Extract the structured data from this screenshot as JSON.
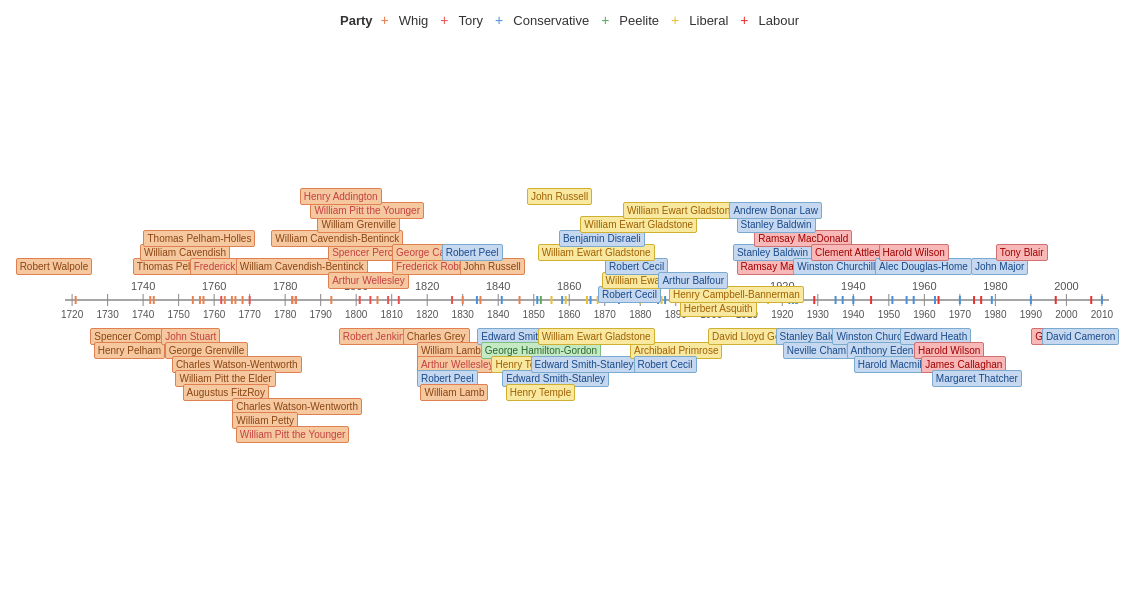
{
  "legend": {
    "party_label": "Party",
    "items": [
      {
        "name": "Whig",
        "color_class": "whig-dot",
        "plus_color": "#e88050"
      },
      {
        "name": "Tory",
        "color_class": "tory-dot",
        "plus_color": "#e85050"
      },
      {
        "name": "Conservative",
        "color_class": "conservative-dot",
        "plus_color": "#4a90d9"
      },
      {
        "name": "Peelite",
        "color_class": "peelite-dot",
        "plus_color": "#5aaa5a"
      },
      {
        "name": "Liberal",
        "color_class": "liberal-dot",
        "plus_color": "#e8c030"
      },
      {
        "name": "Labour",
        "color_class": "labour-dot",
        "plus_color": "#e83030"
      }
    ]
  },
  "axis": {
    "start_year": 1720,
    "end_year": 2010,
    "major_ticks": [
      1720,
      1740,
      1760,
      1780,
      1800,
      1820,
      1840,
      1860,
      1880,
      1900,
      1920,
      1940,
      1960,
      1980,
      2000
    ],
    "top_labels": [
      1740,
      1760,
      1780,
      1800,
      1820,
      1840,
      1860,
      1880,
      1900,
      1920,
      1940,
      1960,
      1980,
      2000
    ],
    "bottom_labels": [
      1720,
      1730,
      1740,
      1750,
      1760,
      1770,
      1780,
      1790,
      1800,
      1810,
      1820,
      1830,
      1840,
      1850,
      1860,
      1870,
      1880,
      1890,
      1900,
      1910,
      1920,
      1930,
      1940,
      1950,
      1960,
      1970,
      1980,
      1990,
      2000,
      2010
    ]
  },
  "prime_ministers": [
    {
      "name": "Robert Walpole",
      "year": 1721,
      "above": true,
      "party": "whig",
      "row": 0
    },
    {
      "name": "Spencer Compton",
      "year": 1742,
      "above": false,
      "party": "whig",
      "row": 0
    },
    {
      "name": "Henry Pelham",
      "year": 1743,
      "above": false,
      "party": "whig",
      "row": 1
    },
    {
      "name": "Thomas Pelham-Holles",
      "year": 1754,
      "above": true,
      "party": "whig",
      "row": 0
    },
    {
      "name": "William Cavendish",
      "year": 1756,
      "above": true,
      "party": "whig",
      "row": 1
    },
    {
      "name": "Thomas Pelham-Holles",
      "year": 1757,
      "above": true,
      "party": "whig",
      "row": 2
    },
    {
      "name": "John Stuart",
      "year": 1762,
      "above": false,
      "party": "tory",
      "row": 0
    },
    {
      "name": "George Grenville",
      "year": 1763,
      "above": false,
      "party": "whig",
      "row": 1
    },
    {
      "name": "Charles Watson-Wentworth",
      "year": 1765,
      "above": false,
      "party": "whig",
      "row": 2
    },
    {
      "name": "William Pitt the Elder",
      "year": 1766,
      "above": false,
      "party": "whig",
      "row": 3
    },
    {
      "name": "Augustus FitzRoy",
      "year": 1768,
      "above": false,
      "party": "whig",
      "row": 4
    },
    {
      "name": "Frederick North",
      "year": 1770,
      "above": true,
      "party": "tory",
      "row": 0
    },
    {
      "name": "Charles Watson-Wentworth",
      "year": 1782,
      "above": false,
      "party": "whig",
      "row": 5
    },
    {
      "name": "William Petty",
      "year": 1782,
      "above": false,
      "party": "whig",
      "row": 6
    },
    {
      "name": "William Cavendish-Bentinck",
      "year": 1783,
      "above": true,
      "party": "whig",
      "row": 0
    },
    {
      "name": "William Pitt the Younger",
      "year": 1783,
      "above": false,
      "party": "tory",
      "row": 7
    },
    {
      "name": "Spencer Perceval",
      "year": 1783,
      "above": true,
      "party": "tory",
      "row": 1
    },
    {
      "name": "William Cavendish-Bentinck",
      "year": 1793,
      "above": true,
      "party": "whig",
      "row": 2
    },
    {
      "name": "William Grenville",
      "year": 1806,
      "above": true,
      "party": "whig",
      "row": 3
    },
    {
      "name": "William Pitt the Younger",
      "year": 1804,
      "above": true,
      "party": "tory",
      "row": 4
    },
    {
      "name": "Henry Addington",
      "year": 1801,
      "above": true,
      "party": "tory",
      "row": 5
    },
    {
      "name": "Arthur Wellesley",
      "year": 1809,
      "above": true,
      "party": "tory",
      "row": -2
    },
    {
      "name": "Frederick Robinson",
      "year": 1827,
      "above": true,
      "party": "tory",
      "row": -1
    },
    {
      "name": "George Canning",
      "year": 1827,
      "above": true,
      "party": "tory",
      "row": 0
    },
    {
      "name": "Robert Jenkinson",
      "year": 1812,
      "above": false,
      "party": "tory",
      "row": 0
    },
    {
      "name": "Charles Grey",
      "year": 1830,
      "above": false,
      "party": "whig",
      "row": 0
    },
    {
      "name": "William Lamb",
      "year": 1834,
      "above": false,
      "party": "whig",
      "row": 1
    },
    {
      "name": "Arthur Wellesley",
      "year": 1834,
      "above": false,
      "party": "tory",
      "row": 2
    },
    {
      "name": "Robert Peel",
      "year": 1834,
      "above": false,
      "party": "conservative",
      "row": 3
    },
    {
      "name": "William Lamb",
      "year": 1835,
      "above": false,
      "party": "whig",
      "row": 4
    },
    {
      "name": "John Russell",
      "year": 1846,
      "above": true,
      "party": "whig",
      "row": 0
    },
    {
      "name": "Robert Peel",
      "year": 1841,
      "above": true,
      "party": "conservative",
      "row": 1
    },
    {
      "name": "Edward Smith-Stanley",
      "year": 1851,
      "above": false,
      "party": "conservative",
      "row": 0
    },
    {
      "name": "George Hamilton-Gordon",
      "year": 1852,
      "above": false,
      "party": "peelite",
      "row": 1
    },
    {
      "name": "Henry Temple",
      "year": 1855,
      "above": false,
      "party": "liberal",
      "row": 2
    },
    {
      "name": "Edward Smith-Stanley",
      "year": 1858,
      "above": false,
      "party": "conservative",
      "row": 3
    },
    {
      "name": "Henry Temple",
      "year": 1859,
      "above": false,
      "party": "liberal",
      "row": 4
    },
    {
      "name": "Benjamin Disraeli",
      "year": 1868,
      "above": false,
      "party": "conservative",
      "row": 0
    },
    {
      "name": "William Ewart Gladstone",
      "year": 1868,
      "above": true,
      "party": "liberal",
      "row": 0
    },
    {
      "name": "Benjamin Disraeli",
      "year": 1875,
      "above": true,
      "party": "conservative",
      "row": 1
    },
    {
      "name": "William Ewart Gladstone",
      "year": 1880,
      "above": true,
      "party": "liberal",
      "row": 2
    },
    {
      "name": "Robert Cecil",
      "year": 1885,
      "above": true,
      "party": "conservative",
      "row": -3
    },
    {
      "name": "William Ewart Gladstone",
      "year": 1886,
      "above": true,
      "party": "liberal",
      "row": -2
    },
    {
      "name": "Robert Cecil",
      "year": 1887,
      "above": true,
      "party": "conservative",
      "row": -1
    },
    {
      "name": "William Ewart Gladstone",
      "year": 1892,
      "above": true,
      "party": "liberal",
      "row": 3
    },
    {
      "name": "Edward Smith-Stanley",
      "year": 1866,
      "above": false,
      "party": "conservative",
      "row": 2
    },
    {
      "name": "John Russell",
      "year": 1865,
      "above": true,
      "party": "liberal",
      "row": 4
    },
    {
      "name": "Archibald Primrose",
      "year": 1894,
      "above": false,
      "party": "liberal",
      "row": 1
    },
    {
      "name": "Robert Cecil",
      "year": 1895,
      "above": false,
      "party": "conservative",
      "row": 2
    },
    {
      "name": "William Ewart Gladstone",
      "year": 1868,
      "above": false,
      "party": "liberal",
      "row": 0
    },
    {
      "name": "Herbert Asquith",
      "year": 1908,
      "above": true,
      "party": "liberal",
      "row": -4
    },
    {
      "name": "Henry Campbell-Bannerman",
      "year": 1905,
      "above": true,
      "party": "liberal",
      "row": -3
    },
    {
      "name": "Arthur Balfour",
      "year": 1902,
      "above": true,
      "party": "conservative",
      "row": -2
    },
    {
      "name": "David Lloyd George",
      "year": 1916,
      "above": false,
      "party": "liberal",
      "row": 0
    },
    {
      "name": "Andrew Bonar Law",
      "year": 1922,
      "above": true,
      "party": "conservative",
      "row": 0
    },
    {
      "name": "Stanley Baldwin",
      "year": 1923,
      "above": true,
      "party": "conservative",
      "row": 1
    },
    {
      "name": "Ramsay MacDonald",
      "year": 1924,
      "above": true,
      "party": "labour",
      "row": 2
    },
    {
      "name": "Stanley Baldwin",
      "year": 1924,
      "above": true,
      "party": "conservative",
      "row": 3
    },
    {
      "name": "Ramsay MacDonald",
      "year": 1929,
      "above": true,
      "party": "labour",
      "row": 4
    },
    {
      "name": "Stanley Baldwin",
      "year": 1935,
      "above": false,
      "party": "conservative",
      "row": 0
    },
    {
      "name": "Neville Chamberlain",
      "year": 1937,
      "above": false,
      "party": "conservative",
      "row": 1
    },
    {
      "name": "Winston Churchill",
      "year": 1940,
      "above": true,
      "party": "conservative",
      "row": 5
    },
    {
      "name": "Clement Attlee",
      "year": 1945,
      "above": true,
      "party": "labour",
      "row": -1
    },
    {
      "name": "Winston Churchill",
      "year": 1950,
      "above": false,
      "party": "conservative",
      "row": 0
    },
    {
      "name": "Anthony Eden",
      "year": 1955,
      "above": false,
      "party": "conservative",
      "row": 1
    },
    {
      "name": "Harold Macmillan",
      "year": 1957,
      "above": false,
      "party": "conservative",
      "row": 2
    },
    {
      "name": "Alec Douglas-Home",
      "year": 1963,
      "above": true,
      "party": "conservative",
      "row": 1
    },
    {
      "name": "Harold Wilson",
      "year": 1964,
      "above": true,
      "party": "labour",
      "row": 0
    },
    {
      "name": "Edward Heath",
      "year": 1970,
      "above": false,
      "party": "conservative",
      "row": 0
    },
    {
      "name": "Harold Wilson",
      "year": 1974,
      "above": false,
      "party": "labour",
      "row": 1
    },
    {
      "name": "James Callaghan",
      "year": 1976,
      "above": false,
      "party": "labour",
      "row": 2
    },
    {
      "name": "Margaret Thatcher",
      "year": 1979,
      "above": false,
      "party": "conservative",
      "row": 3
    },
    {
      "name": "John Major",
      "year": 1990,
      "above": true,
      "party": "conservative",
      "row": 1
    },
    {
      "name": "Tony Blair",
      "year": 1997,
      "above": true,
      "party": "labour",
      "row": 0
    },
    {
      "name": "Gordon Brown",
      "year": 2007,
      "above": false,
      "party": "labour",
      "row": 0
    },
    {
      "name": "David Cameron",
      "year": 2010,
      "above": true,
      "party": "conservative",
      "row": 0
    }
  ]
}
